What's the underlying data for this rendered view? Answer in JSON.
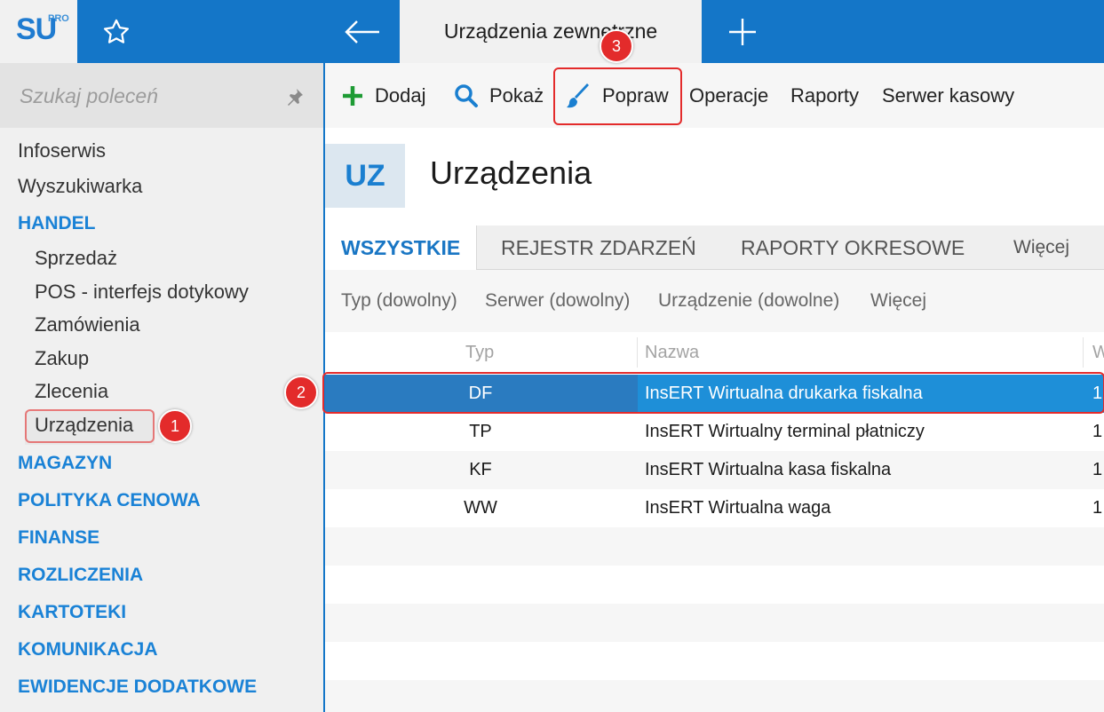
{
  "app": {
    "logo_text": "SU",
    "logo_sup": "PRO",
    "active_tab": "Urządzenia zewnętrzne",
    "icons": [
      "star-icon",
      "back-arrow-icon",
      "plus-icon"
    ]
  },
  "sidebar": {
    "search_placeholder": "Szukaj poleceń",
    "items": [
      {
        "label": "Infoserwis",
        "kind": "item"
      },
      {
        "label": "Wyszukiwarka",
        "kind": "item"
      },
      {
        "label": "HANDEL",
        "kind": "section"
      },
      {
        "label": "Sprzedaż",
        "kind": "sub"
      },
      {
        "label": "POS - interfejs dotykowy",
        "kind": "sub"
      },
      {
        "label": "Zamówienia",
        "kind": "sub"
      },
      {
        "label": "Zakup",
        "kind": "sub"
      },
      {
        "label": "Zlecenia",
        "kind": "sub"
      },
      {
        "label": "Urządzenia",
        "kind": "sub",
        "selected": true
      },
      {
        "label": "MAGAZYN",
        "kind": "section"
      },
      {
        "label": "POLITYKA CENOWA",
        "kind": "section"
      },
      {
        "label": "FINANSE",
        "kind": "section"
      },
      {
        "label": "ROZLICZENIA",
        "kind": "section"
      },
      {
        "label": "KARTOTEKI",
        "kind": "section"
      },
      {
        "label": "KOMUNIKACJA",
        "kind": "section"
      },
      {
        "label": "EWIDENCJE DODATKOWE",
        "kind": "section"
      }
    ]
  },
  "toolbar": {
    "dodaj": "Dodaj",
    "pokaz": "Pokaż",
    "popraw": "Popraw",
    "operacje": "Operacje",
    "raporty": "Raporty",
    "serwer": "Serwer kasowy"
  },
  "header": {
    "badge": "UZ",
    "title": "Urządzenia"
  },
  "tabs": {
    "wszystkie": "WSZYSTKIE",
    "rejestr": "REJESTR ZDARZEŃ",
    "raporty": "RAPORTY OKRESOWE",
    "wiecej": "Więcej"
  },
  "filters": {
    "typ": "Typ (dowolny)",
    "serwer": "Serwer (dowolny)",
    "urzadzenie": "Urządzenie (dowolne)",
    "wiecej": "Więcej"
  },
  "grid": {
    "columns": {
      "typ": "Typ",
      "nazwa": "Nazwa",
      "w": "W"
    },
    "rows": [
      {
        "typ": "DF",
        "nazwa": "InsERT Wirtualna drukarka fiskalna",
        "w": "1"
      },
      {
        "typ": "TP",
        "nazwa": "InsERT Wirtualny terminal płatniczy",
        "w": "1"
      },
      {
        "typ": "KF",
        "nazwa": "InsERT Wirtualna kasa fiskalna",
        "w": "1"
      },
      {
        "typ": "WW",
        "nazwa": "InsERT Wirtualna waga",
        "w": "1"
      }
    ]
  },
  "annotations": {
    "one": "1",
    "two": "2",
    "three": "3",
    "color": "#e32b2b"
  },
  "colors": {
    "brand": "#1476c8",
    "accent": "#1a82d6",
    "selected_row": "#1e8fd8"
  }
}
